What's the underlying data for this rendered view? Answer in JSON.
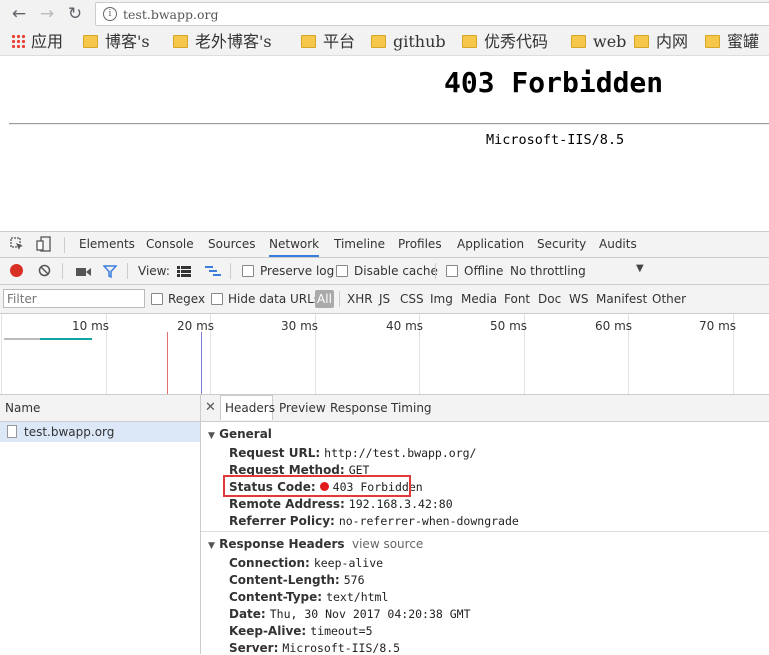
{
  "browser": {
    "url": "test.bwapp.org",
    "bookmarks": [
      "应用",
      "博客's",
      "老外博客's",
      "平台",
      "github",
      "优秀代码",
      "web",
      "内网",
      "蜜罐"
    ]
  },
  "page": {
    "heading": "403 Forbidden",
    "server": "Microsoft-IIS/8.5"
  },
  "devtools": {
    "tabs": [
      "Elements",
      "Console",
      "Sources",
      "Network",
      "Timeline",
      "Profiles",
      "Application",
      "Security",
      "Audits"
    ],
    "active_tab": "Network",
    "toolbar": {
      "view_label": "View:",
      "preserve_log": "Preserve log",
      "disable_cache": "Disable cache",
      "offline": "Offline",
      "throttling": "No throttling"
    },
    "filter": {
      "placeholder": "Filter",
      "regex": "Regex",
      "hide_data_urls": "Hide data URLs",
      "types": [
        "All",
        "XHR",
        "JS",
        "CSS",
        "Img",
        "Media",
        "Font",
        "Doc",
        "WS",
        "Manifest",
        "Other"
      ]
    },
    "timeline_ticks": [
      "10 ms",
      "20 ms",
      "30 ms",
      "40 ms",
      "50 ms",
      "60 ms",
      "70 ms"
    ],
    "name_column": "Name",
    "requests": [
      "test.bwapp.org"
    ],
    "detail_tabs": [
      "Headers",
      "Preview",
      "Response",
      "Timing"
    ],
    "general": {
      "title": "General",
      "request_url_key": "Request URL:",
      "request_url": "http://test.bwapp.org/",
      "request_method_key": "Request Method:",
      "request_method": "GET",
      "status_code_key": "Status Code:",
      "status_code": "403 Forbidden",
      "remote_address_key": "Remote Address:",
      "remote_address": "192.168.3.42:80",
      "referrer_policy_key": "Referrer Policy:",
      "referrer_policy": "no-referrer-when-downgrade"
    },
    "response_headers": {
      "title": "Response Headers",
      "view_source": "view source",
      "items": [
        {
          "key": "Connection:",
          "value": "keep-alive"
        },
        {
          "key": "Content-Length:",
          "value": "576"
        },
        {
          "key": "Content-Type:",
          "value": "text/html"
        },
        {
          "key": "Date:",
          "value": "Thu, 30 Nov 2017 04:20:38 GMT"
        },
        {
          "key": "Keep-Alive:",
          "value": "timeout=5"
        },
        {
          "key": "Server:",
          "value": "Microsoft-IIS/8.5"
        }
      ]
    },
    "colors": {
      "record": "#d93025",
      "status_dot": "#e21a1a",
      "highlight_box": "#e03a3a",
      "selected_row": "#dce8f7",
      "active_tab_underline": "#3b7ddd"
    }
  }
}
